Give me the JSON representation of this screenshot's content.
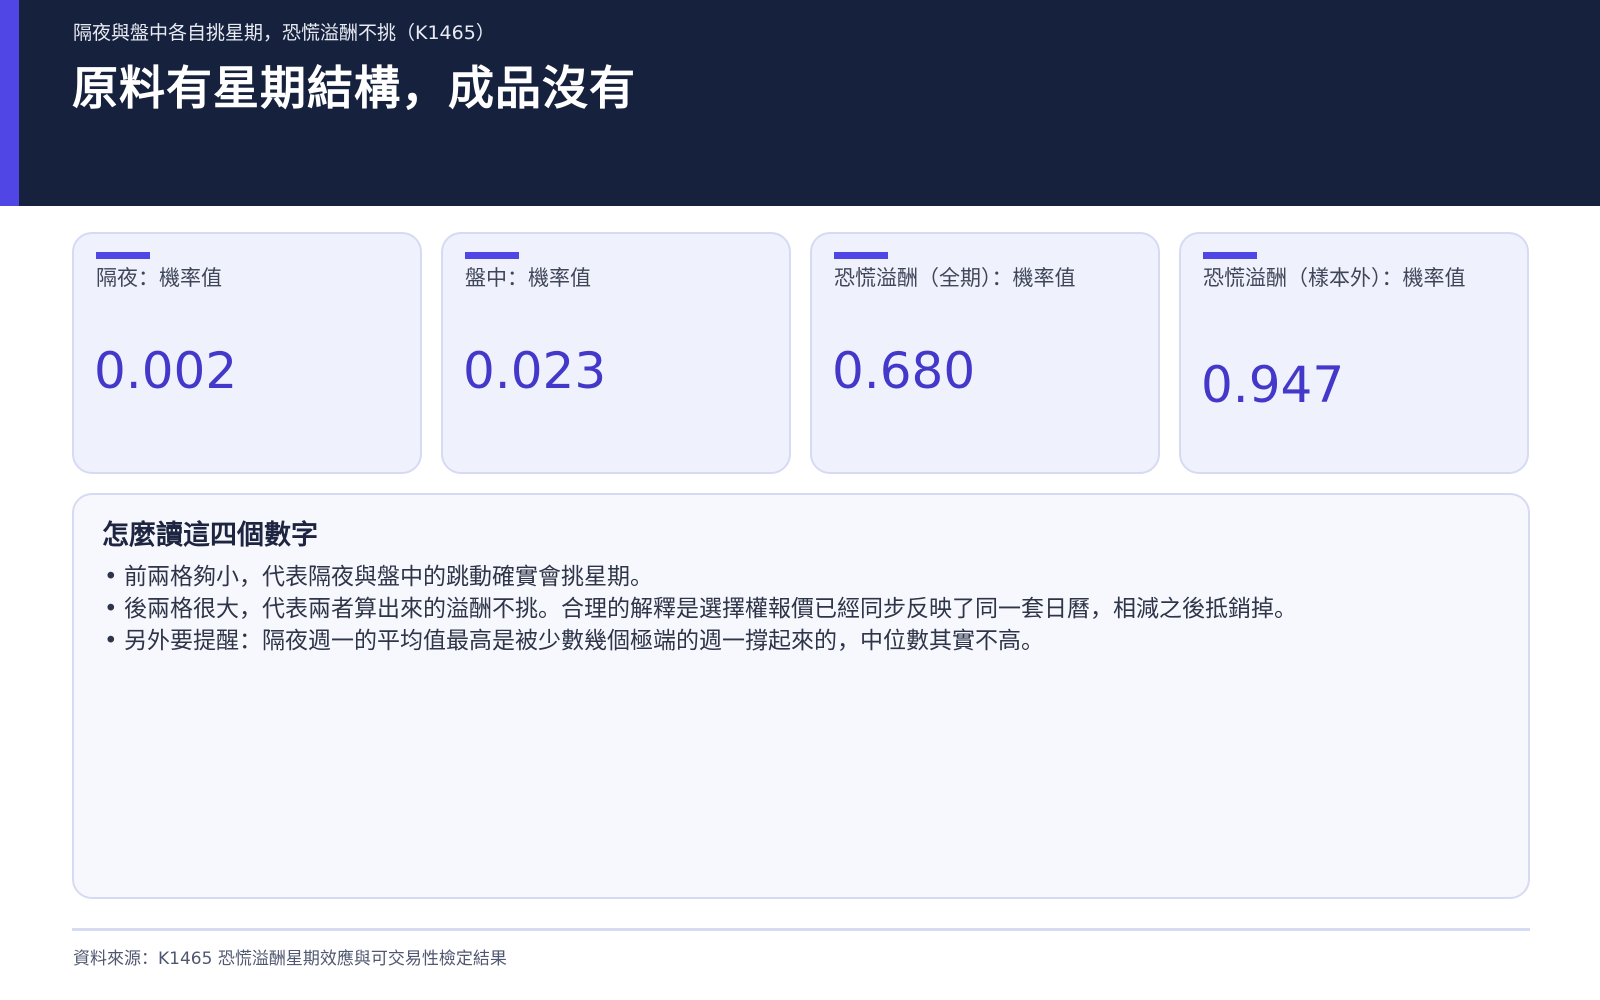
{
  "header": {
    "kicker": "隔夜與盤中各自挑星期，恐慌溢酬不挑（K1465）",
    "title": "原料有星期結構，成品沒有"
  },
  "cards": [
    {
      "label": "隔夜：機率值",
      "value": "0.002"
    },
    {
      "label": "盤中：機率值",
      "value": "0.023"
    },
    {
      "label": "恐慌溢酬（全期）：機率值",
      "value": "0.680"
    },
    {
      "label": "恐慌溢酬（樣本外）：機率值",
      "value": "0.947"
    }
  ],
  "notes": {
    "title": "怎麼讀這四個數字",
    "bullet": "•",
    "items": [
      "前兩格夠小，代表隔夜與盤中的跳動確實會挑星期。",
      "後兩格很大，代表兩者算出來的溢酬不挑。合理的解釋是選擇權報價已經同步反映了同一套日曆，相減之後抵銷掉。",
      "另外要提醒：隔夜週一的平均值最高是被少數幾個極端的週一撐起來的，中位數其實不高。"
    ]
  },
  "footer": {
    "source": "資料來源：K1465 恐慌溢酬星期效應與可交易性檢定結果"
  },
  "colors": {
    "header_bg": "#16223d",
    "accent": "#4f46e5",
    "value_text": "#4338ca",
    "card_bg": "#eff1fc",
    "card_border": "#d6daf3"
  }
}
